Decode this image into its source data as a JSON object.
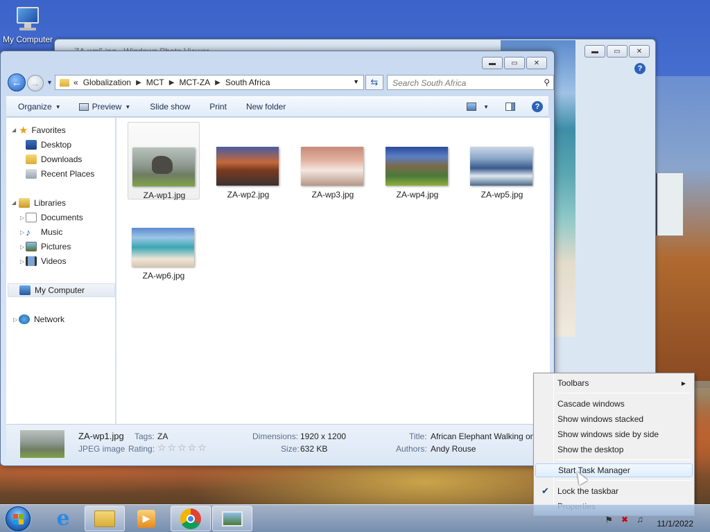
{
  "desktop": {
    "icon_label": "My Computer"
  },
  "photo_viewer": {
    "title": "ZA-wp6.jpg - Windows Photo Viewer"
  },
  "explorer": {
    "address": {
      "overflow": "«",
      "crumbs": [
        "Globalization",
        "MCT",
        "MCT-ZA",
        "South Africa"
      ]
    },
    "search_placeholder": "Search South Africa",
    "toolbar": {
      "organize": "Organize",
      "preview": "Preview",
      "slideshow": "Slide show",
      "print": "Print",
      "new_folder": "New folder"
    },
    "nav": {
      "favorites": "Favorites",
      "desktop": "Desktop",
      "downloads": "Downloads",
      "recent_places": "Recent Places",
      "libraries": "Libraries",
      "documents": "Documents",
      "music": "Music",
      "pictures": "Pictures",
      "videos": "Videos",
      "my_computer": "My Computer",
      "network": "Network"
    },
    "files": [
      {
        "name": "ZA-wp1.jpg"
      },
      {
        "name": "ZA-wp2.jpg"
      },
      {
        "name": "ZA-wp3.jpg"
      },
      {
        "name": "ZA-wp4.jpg"
      },
      {
        "name": "ZA-wp5.jpg"
      },
      {
        "name": "ZA-wp6.jpg"
      }
    ],
    "details": {
      "filename": "ZA-wp1.jpg",
      "filetype": "JPEG image",
      "tags_label": "Tags:",
      "tags_value": "ZA",
      "rating_label": "Rating:",
      "rating_stars": "☆☆☆☆☆",
      "dimensions_label": "Dimensions:",
      "dimensions_value": "1920 x 1200",
      "size_label": "Size:",
      "size_value": "632 KB",
      "title_label": "Title:",
      "title_value": "African Elephant Walking on",
      "authors_label": "Authors:",
      "authors_value": "Andy Rouse"
    }
  },
  "context_menu": {
    "toolbars": "Toolbars",
    "cascade": "Cascade windows",
    "stacked": "Show windows stacked",
    "side_by_side": "Show windows side by side",
    "show_desktop": "Show the desktop",
    "task_manager": "Start Task Manager",
    "lock_taskbar": "Lock the taskbar",
    "properties": "Properties"
  },
  "taskbar": {
    "clock_date": "11/1/2022"
  }
}
